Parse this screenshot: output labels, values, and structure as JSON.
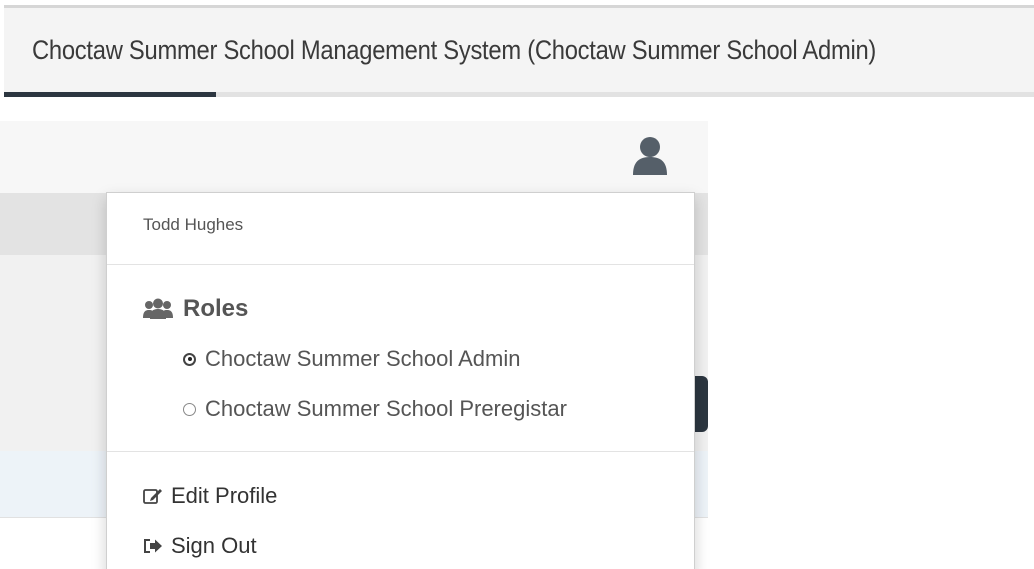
{
  "header": {
    "title": "Choctaw Summer School Management System (Choctaw Summer School Admin)"
  },
  "navbar": {
    "user_icon": "user-icon"
  },
  "user_menu": {
    "username": "Todd Hughes",
    "roles_title": "Roles",
    "roles_icon": "users-group-icon",
    "roles": [
      {
        "label": "Choctaw Summer School Admin",
        "selected": true
      },
      {
        "label": "Choctaw Summer School Preregistar",
        "selected": false
      }
    ],
    "actions": [
      {
        "label": "Edit Profile",
        "icon": "edit-icon"
      },
      {
        "label": "Sign Out",
        "icon": "sign-out-icon"
      }
    ]
  },
  "colors": {
    "accent_dark": "#2c3640",
    "text": "#555555"
  }
}
